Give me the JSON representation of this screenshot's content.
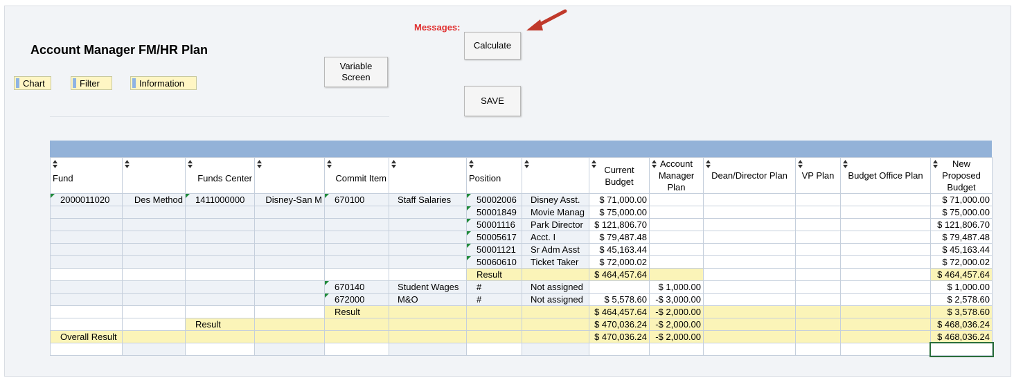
{
  "page": {
    "title": "Account Manager FM/HR Plan",
    "messages_label": "Messages:"
  },
  "toolbar": {
    "chart": "Chart",
    "filter": "Filter",
    "information": "Information"
  },
  "buttons": {
    "variable_screen": "Variable Screen",
    "calculate": "Calculate",
    "save": "SAVE"
  },
  "columns": [
    "Fund",
    "",
    "Funds Center",
    "",
    "Commit Item",
    "",
    "Position",
    "",
    "Current Budget",
    "Account Manager Plan",
    "Dean/Director Plan",
    "VP Plan",
    "Budget Office Plan",
    "New Proposed Budget"
  ],
  "rows": [
    {
      "fund": "2000011020",
      "fund_desc": "Des Method",
      "funds_center": "1411000000",
      "fc_desc": "Disney-San M",
      "commit": "670100",
      "commit_desc": "Staff Salaries",
      "position": "50002006",
      "pos_desc": "Disney Asst.",
      "current": "$ 71,000.00",
      "am": "",
      "dd": "",
      "vp": "",
      "bo": "",
      "new": "$ 71,000.00",
      "type": "data"
    },
    {
      "fund": "",
      "fund_desc": "",
      "funds_center": "",
      "fc_desc": "",
      "commit": "",
      "commit_desc": "",
      "position": "50001849",
      "pos_desc": "Movie Manag",
      "current": "$ 75,000.00",
      "am": "",
      "dd": "",
      "vp": "",
      "bo": "",
      "new": "$ 75,000.00",
      "type": "data"
    },
    {
      "fund": "",
      "fund_desc": "",
      "funds_center": "",
      "fc_desc": "",
      "commit": "",
      "commit_desc": "",
      "position": "50001116",
      "pos_desc": "Park Director",
      "current": "$ 121,806.70",
      "am": "",
      "dd": "",
      "vp": "",
      "bo": "",
      "new": "$ 121,806.70",
      "type": "data"
    },
    {
      "fund": "",
      "fund_desc": "",
      "funds_center": "",
      "fc_desc": "",
      "commit": "",
      "commit_desc": "",
      "position": "50005617",
      "pos_desc": "Acct. I",
      "current": "$ 79,487.48",
      "am": "",
      "dd": "",
      "vp": "",
      "bo": "",
      "new": "$ 79,487.48",
      "type": "data"
    },
    {
      "fund": "",
      "fund_desc": "",
      "funds_center": "",
      "fc_desc": "",
      "commit": "",
      "commit_desc": "",
      "position": "50001121",
      "pos_desc": "Sr Adm Asst",
      "current": "$ 45,163.44",
      "am": "",
      "dd": "",
      "vp": "",
      "bo": "",
      "new": "$ 45,163.44",
      "type": "data"
    },
    {
      "fund": "",
      "fund_desc": "",
      "funds_center": "",
      "fc_desc": "",
      "commit": "",
      "commit_desc": "",
      "position": "50060610",
      "pos_desc": "Ticket Taker",
      "current": "$ 72,000.02",
      "am": "",
      "dd": "",
      "vp": "",
      "bo": "",
      "new": "$ 72,000.02",
      "type": "data"
    },
    {
      "fund": "",
      "fund_desc": "",
      "funds_center": "",
      "fc_desc": "",
      "commit": "",
      "commit_desc": "",
      "position": "Result",
      "pos_desc": "",
      "current": "$ 464,457.64",
      "am": "",
      "dd": "",
      "vp": "",
      "bo": "",
      "new": "$ 464,457.64",
      "type": "res-pos"
    },
    {
      "fund": "",
      "fund_desc": "",
      "funds_center": "",
      "fc_desc": "",
      "commit": "670140",
      "commit_desc": "Student Wages",
      "position": "#",
      "pos_desc": "Not assigned",
      "current": "",
      "am": "$ 1,000.00",
      "dd": "",
      "vp": "",
      "bo": "",
      "new": "$ 1,000.00",
      "type": "data"
    },
    {
      "fund": "",
      "fund_desc": "",
      "funds_center": "",
      "fc_desc": "",
      "commit": "672000",
      "commit_desc": "M&O",
      "position": "#",
      "pos_desc": "Not assigned",
      "current": "$ 5,578.60",
      "am": "-$ 3,000.00",
      "dd": "",
      "vp": "",
      "bo": "",
      "new": "$ 2,578.60",
      "type": "data"
    },
    {
      "fund": "",
      "fund_desc": "",
      "funds_center": "",
      "fc_desc": "",
      "commit": "Result",
      "commit_desc": "",
      "position": "",
      "pos_desc": "",
      "current": "$ 464,457.64",
      "am": "-$ 2,000.00",
      "dd": "",
      "vp": "",
      "bo": "",
      "new": "$ 3,578.60",
      "type": "res-commit"
    },
    {
      "fund": "",
      "fund_desc": "",
      "funds_center": "Result",
      "fc_desc": "",
      "commit": "",
      "commit_desc": "",
      "position": "",
      "pos_desc": "",
      "current": "$ 470,036.24",
      "am": "-$ 2,000.00",
      "dd": "",
      "vp": "",
      "bo": "",
      "new": "$ 468,036.24",
      "type": "res-fc"
    },
    {
      "fund": "Overall Result",
      "fund_desc": "",
      "funds_center": "",
      "fc_desc": "",
      "commit": "",
      "commit_desc": "",
      "position": "",
      "pos_desc": "",
      "current": "$ 470,036.24",
      "am": "-$ 2,000.00",
      "dd": "",
      "vp": "",
      "bo": "",
      "new": "$ 468,036.24",
      "type": "res-all"
    },
    {
      "fund": "",
      "fund_desc": "",
      "funds_center": "",
      "fc_desc": "",
      "commit": "",
      "commit_desc": "",
      "position": "",
      "pos_desc": "",
      "current": "",
      "am": "",
      "dd": "",
      "vp": "",
      "bo": "",
      "new": "",
      "type": "empty"
    }
  ],
  "colors": {
    "accent_blue": "#93b2d8",
    "result_yellow": "#fbf4b8",
    "messages_red": "#e03030",
    "arrow_red": "#c0392b"
  }
}
